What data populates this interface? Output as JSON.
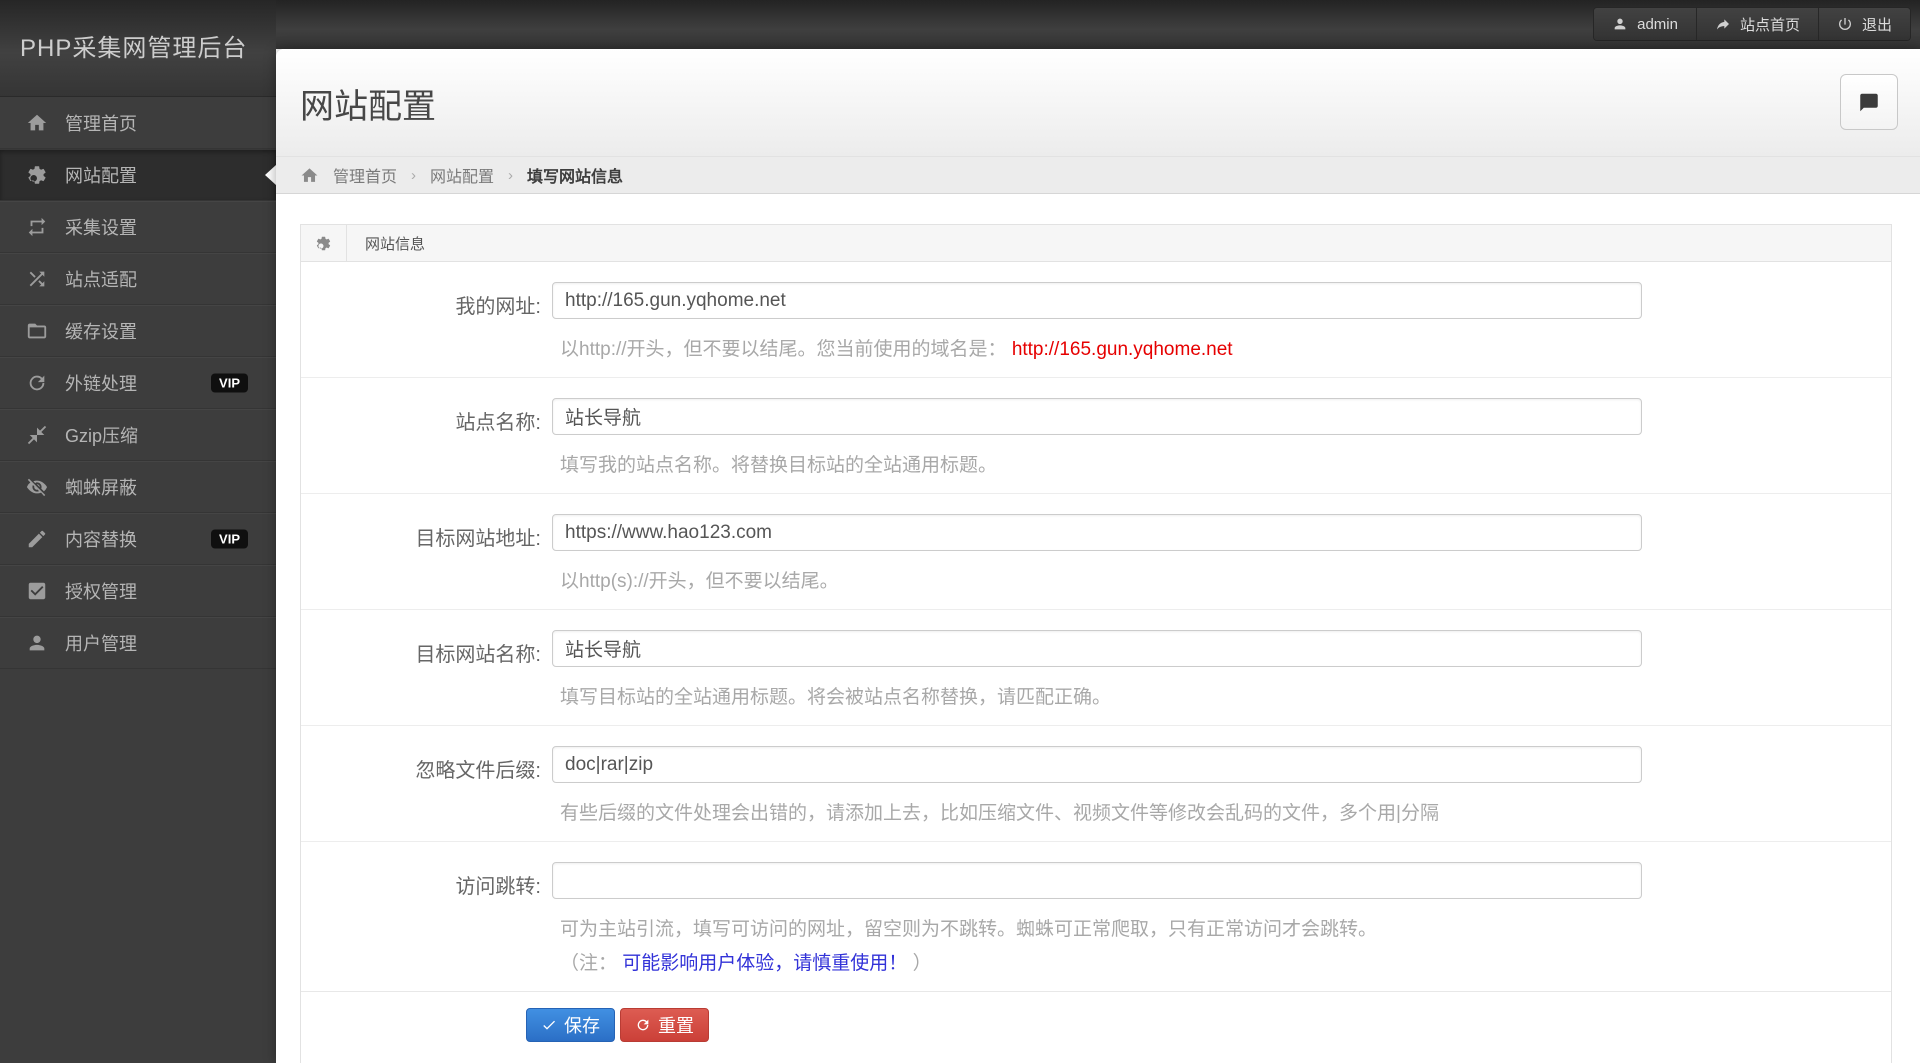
{
  "topbar": {
    "logo": "PHP采集网管理后台",
    "user": "admin",
    "site_home": "站点首页",
    "logout": "退出"
  },
  "sidebar": {
    "vip_label": "VIP",
    "items": [
      {
        "label": "管理首页",
        "icon": "home-icon"
      },
      {
        "label": "网站配置",
        "icon": "gear-icon",
        "active": true
      },
      {
        "label": "采集设置",
        "icon": "repeat-icon"
      },
      {
        "label": "站点适配",
        "icon": "shuffle-icon"
      },
      {
        "label": "缓存设置",
        "icon": "folder-icon"
      },
      {
        "label": "外链处理",
        "icon": "refresh-icon",
        "vip": true
      },
      {
        "label": "Gzip压缩",
        "icon": "compress-icon"
      },
      {
        "label": "蜘蛛屏蔽",
        "icon": "eye-slash-icon"
      },
      {
        "label": "内容替换",
        "icon": "pencil-icon",
        "vip": true
      },
      {
        "label": "授权管理",
        "icon": "check-square-icon"
      },
      {
        "label": "用户管理",
        "icon": "user-icon"
      }
    ]
  },
  "page": {
    "title": "网站配置",
    "breadcrumb": {
      "home": "管理首页",
      "section": "网站配置",
      "current": "填写网站信息",
      "separator": "›"
    }
  },
  "panel": {
    "title": "网站信息",
    "rows": [
      {
        "label": "我的网址:",
        "value": "http://165.gun.yqhome.net",
        "help": "以http://开头，但不要以结尾。您当前使用的域名是： ",
        "help_link_red": "http://165.gun.yqhome.net"
      },
      {
        "label": "站点名称:",
        "value": "站长导航",
        "help": "填写我的站点名称。将替换目标站的全站通用标题。"
      },
      {
        "label": "目标网站地址:",
        "value": "https://www.hao123.com",
        "help": "以http(s)://开头，但不要以结尾。"
      },
      {
        "label": "目标网站名称:",
        "value": "站长导航",
        "help": "填写目标站的全站通用标题。将会被站点名称替换，请匹配正确。"
      },
      {
        "label": "忽略文件后缀:",
        "value": "doc|rar|zip",
        "help": "有些后缀的文件处理会出错的，请添加上去，比如压缩文件、视频文件等修改会乱码的文件，多个用|分隔"
      },
      {
        "label": "访问跳转:",
        "value": "",
        "help": "可为主站引流，填写可访问的网址，留空则为不跳转。蜘蛛可正常爬取，只有正常访问才会跳转。",
        "note_prefix": "（注： ",
        "note_link": "可能影响用户体验，请慎重使用！",
        "note_suffix": " ）"
      }
    ],
    "save_label": "保存",
    "reset_label": "重置"
  },
  "colors": {
    "red_link": "#e60000",
    "blue_link": "#3232d8",
    "save_button": "#2b6fc6",
    "reset_button": "#cb4038",
    "vip_badge": "#0f0f0f",
    "sidebar_bg": "#3d3d3d"
  }
}
